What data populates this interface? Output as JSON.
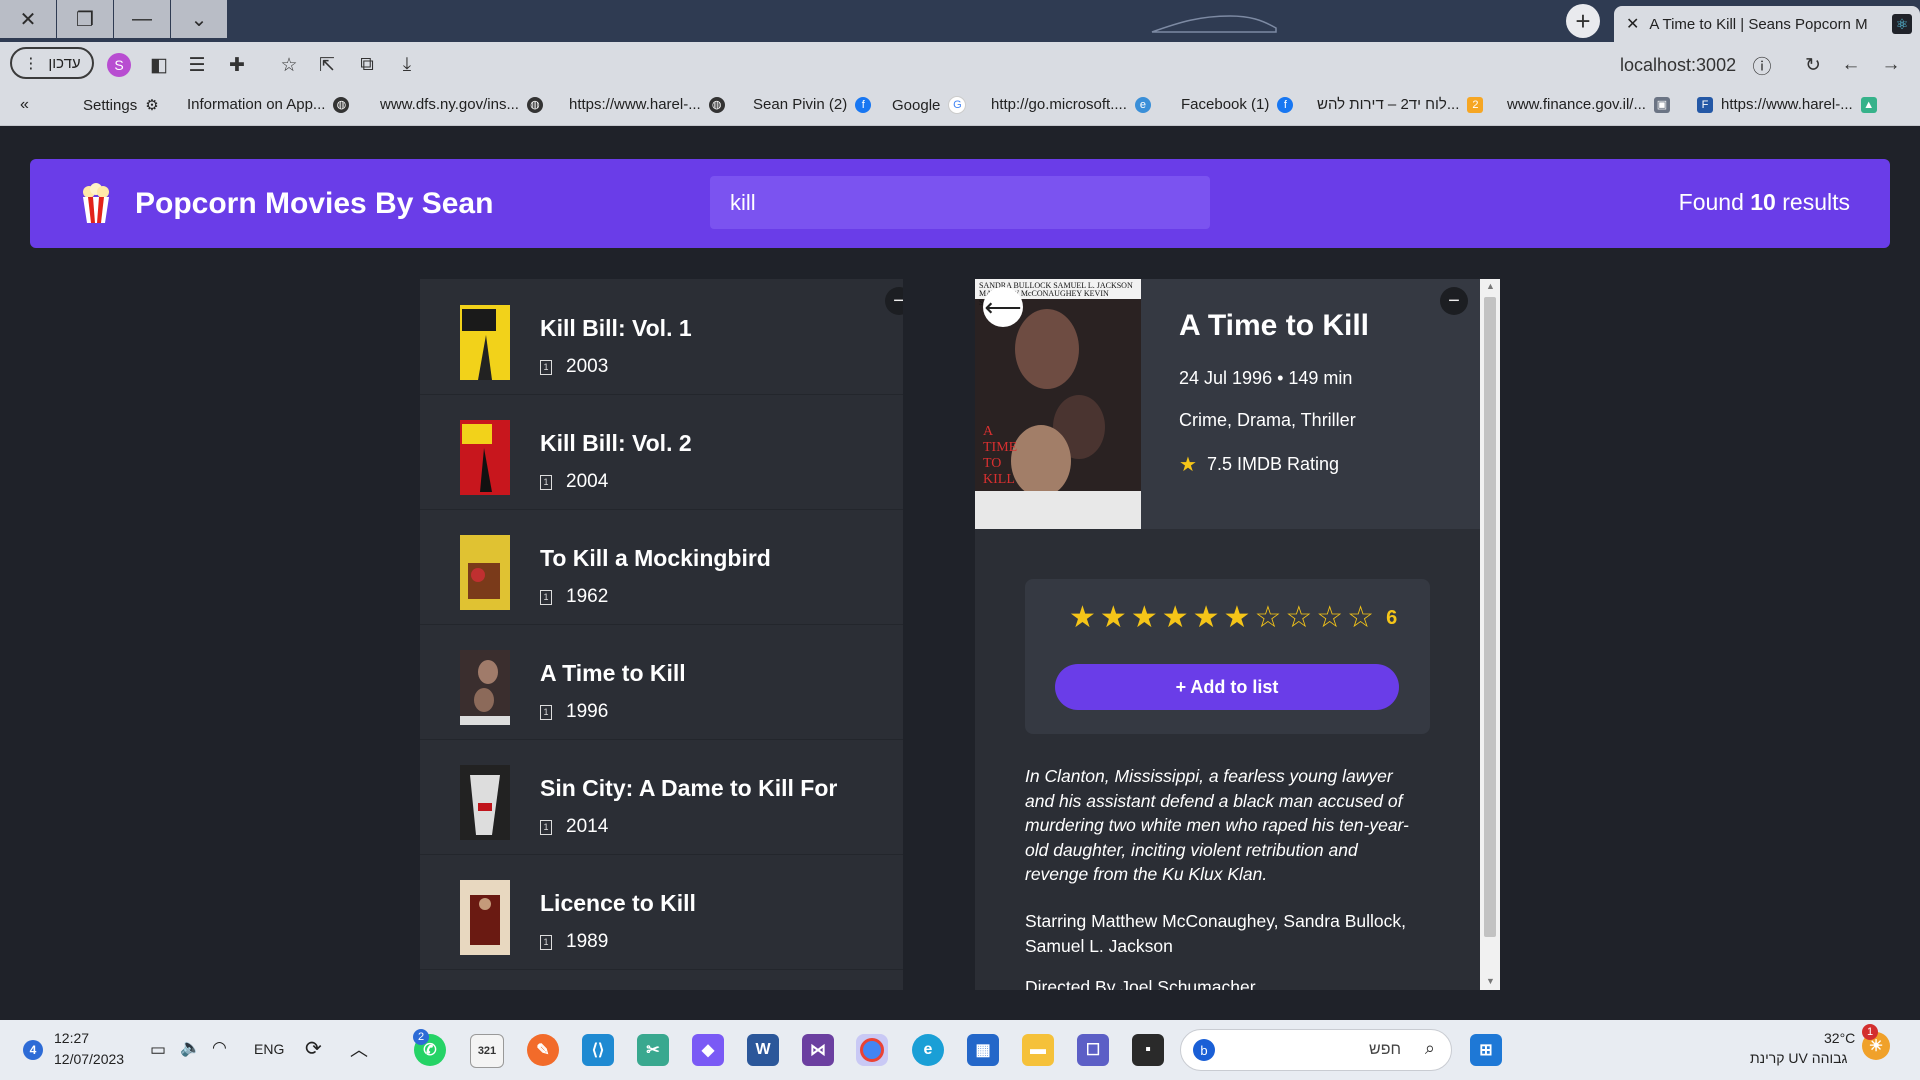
{
  "browser": {
    "tab_title": "A Time to Kill | Seans Popcorn M",
    "update_label": "עדכון",
    "profile_letter": "S",
    "url": "localhost:3002",
    "bookmarks": [
      {
        "label": "Settings",
        "icon": "gear-icon"
      },
      {
        "label": "Information on App...",
        "icon": "globe-icon"
      },
      {
        "label": "www.dfs.ny.gov/ins...",
        "icon": "globe-icon"
      },
      {
        "label": "https://www.harel-...",
        "icon": "globe-icon"
      },
      {
        "label": "Sean Pivin (2)",
        "icon": "facebook-icon"
      },
      {
        "label": "Google",
        "icon": "google-icon"
      },
      {
        "label": "http://go.microsoft....",
        "icon": "edge-icon"
      },
      {
        "label": "Facebook (1)",
        "icon": "facebook-icon"
      },
      {
        "label": "לוח יד2 – דירות להש...",
        "icon": "yad2-icon"
      },
      {
        "label": "www.finance.gov.il/...",
        "icon": "finance-icon"
      },
      {
        "label": "https://www.harel-...",
        "icon": "harel-icon"
      }
    ]
  },
  "app": {
    "title": "Popcorn Movies By Sean",
    "search_value": "kill",
    "found_prefix": "Found",
    "found_count": "10",
    "found_suffix": "results"
  },
  "results": [
    {
      "title": "Kill Bill: Vol. 1",
      "year": "2003",
      "poster_color": "#f2d21a"
    },
    {
      "title": "Kill Bill: Vol. 2",
      "year": "2004",
      "poster_color": "#c8161d"
    },
    {
      "title": "To Kill a Mockingbird",
      "year": "1962",
      "poster_color": "#e0c232"
    },
    {
      "title": "A Time to Kill",
      "year": "1996",
      "poster_color": "#3a2e2e"
    },
    {
      "title": "Sin City: A Dame to Kill For",
      "year": "2014",
      "poster_color": "#5a5a5a"
    },
    {
      "title": "Licence to Kill",
      "year": "1989",
      "poster_color": "#8a2a1e"
    }
  ],
  "detail": {
    "title": "A Time to Kill",
    "release_runtime": "24 Jul 1996 • 149 min",
    "genres": "Crime, Drama, Thriller",
    "imdb": "7.5 IMDB Rating",
    "poster_text_top": "SANDRA BULLOCK   SAMUEL L. JACKSON",
    "poster_text_mid": "MATTHEW McCONAUGHEY   KEVIN SPACEY",
    "poster_title": "A TIME TO KILL",
    "user_rating": 6,
    "user_rating_label": "6",
    "add_button": "+ Add to list",
    "plot": "In Clanton, Mississippi, a fearless young lawyer and his assistant defend a black man accused of murdering two white men who raped his ten-year-old daughter, inciting violent retribution and revenge from the Ku Klux Klan.",
    "cast": "Starring Matthew McConaughey, Sandra Bullock, Samuel L. Jackson",
    "director": "Directed By Joel Schumacher"
  },
  "taskbar": {
    "time": "12:27",
    "date": "12/07/2023",
    "lang": "ENG",
    "notif_count": "4",
    "whatsapp_badge": "2",
    "calendar_day": "321",
    "search_placeholder": "חפש",
    "temperature": "32°C",
    "weather": "קרינת UV גבוהה",
    "weather_badge": "1"
  }
}
